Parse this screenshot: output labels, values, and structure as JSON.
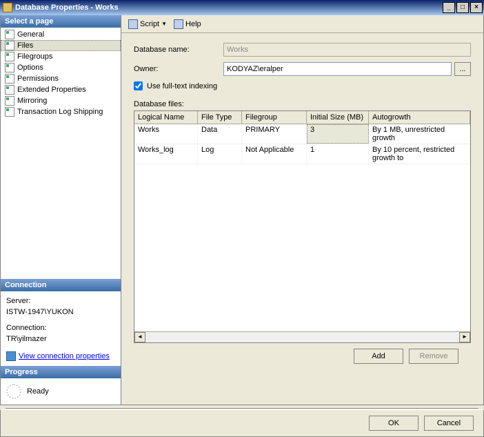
{
  "title": "Database Properties - Works",
  "winbtns": {
    "min": "_",
    "max": "□",
    "close": "×"
  },
  "sidebar": {
    "selectHead": "Select a page",
    "items": [
      {
        "label": "General"
      },
      {
        "label": "Files"
      },
      {
        "label": "Filegroups"
      },
      {
        "label": "Options"
      },
      {
        "label": "Permissions"
      },
      {
        "label": "Extended Properties"
      },
      {
        "label": "Mirroring"
      },
      {
        "label": "Transaction Log Shipping"
      }
    ],
    "connHead": "Connection",
    "serverLabel": "Server:",
    "serverValue": "ISTW-1947\\YUKON",
    "connLabel": "Connection:",
    "connValue": "TR\\yilmazer",
    "viewConn": "View connection properties",
    "progHead": "Progress",
    "progStatus": "Ready"
  },
  "toolbar": {
    "script": "Script",
    "help": "Help"
  },
  "form": {
    "dbnameLabel": "Database name:",
    "dbnameValue": "Works",
    "ownerLabel": "Owner:",
    "ownerValue": "KODYAZ\\eralper",
    "browse": "...",
    "fulltextLabel": "Use full-text indexing",
    "filesLabel": "Database files:"
  },
  "grid": {
    "cols": [
      "Logical Name",
      "File Type",
      "Filegroup",
      "Initial Size (MB)",
      "Autogrowth"
    ],
    "rows": [
      {
        "c": [
          "Works",
          "Data",
          "PRIMARY",
          "3",
          "By 1 MB, unrestricted growth"
        ],
        "selCol": 3
      },
      {
        "c": [
          "Works_log",
          "Log",
          "Not Applicable",
          "1",
          "By 10 percent, restricted growth to"
        ],
        "selCol": -1
      }
    ]
  },
  "buttons": {
    "add": "Add",
    "remove": "Remove",
    "ok": "OK",
    "cancel": "Cancel"
  }
}
